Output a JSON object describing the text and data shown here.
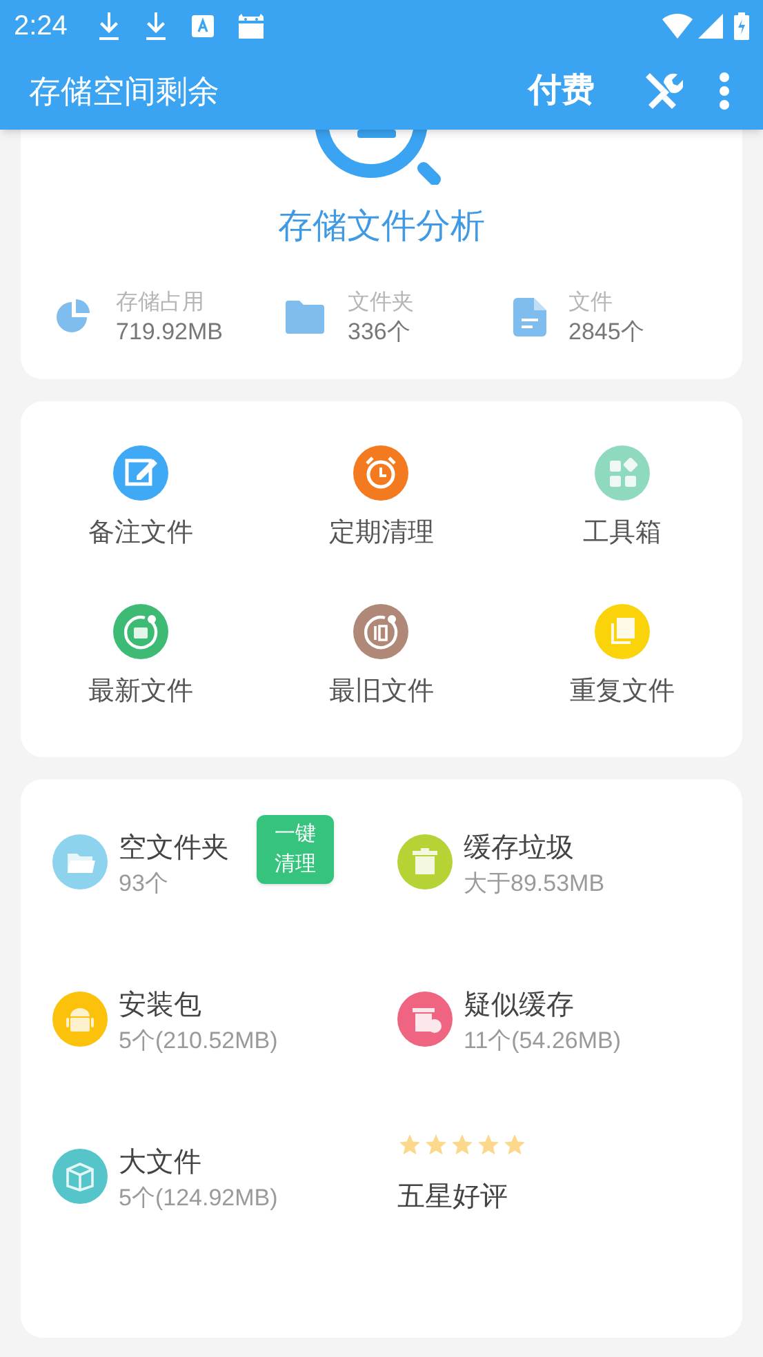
{
  "status_bar": {
    "time": "2:24"
  },
  "app_bar": {
    "title": "存储空间剩余",
    "pay_label": "付费"
  },
  "analysis": {
    "title": "存储文件分析",
    "stats": [
      {
        "kind": "pie",
        "label": "存储占用",
        "value": "719.92MB"
      },
      {
        "kind": "folder",
        "label": "文件夹",
        "value": "336个"
      },
      {
        "kind": "file",
        "label": "文件",
        "value": "2845个"
      }
    ]
  },
  "shortcuts": [
    {
      "kind": "note",
      "label": "备注文件",
      "color": "#3fa9f5"
    },
    {
      "kind": "alarm",
      "label": "定期清理",
      "color": "#f47a20"
    },
    {
      "kind": "grid",
      "label": "工具箱",
      "color": "#8fd9bf"
    },
    {
      "kind": "new",
      "label": "最新文件",
      "color": "#3dbb75"
    },
    {
      "kind": "old",
      "label": "最旧文件",
      "color": "#b08878"
    },
    {
      "kind": "copy",
      "label": "重复文件",
      "color": "#fbd30a"
    }
  ],
  "categories": [
    {
      "kind": "stat",
      "title": "空文件夹",
      "detail": "93个",
      "color": "#8dd3ee",
      "action": "一键清理"
    },
    {
      "kind": "stat",
      "title": "缓存垃圾",
      "detail": "大于89.53MB",
      "color": "#b5d334"
    },
    {
      "kind": "stat",
      "title": "安装包",
      "detail": "5个(210.52MB)",
      "color": "#fcc10b"
    },
    {
      "kind": "stat",
      "title": "疑似缓存",
      "detail": "11个(54.26MB)",
      "color": "#ef6480"
    },
    {
      "kind": "stat",
      "title": "大文件",
      "detail": "5个(124.92MB)",
      "color": "#55c5c9"
    },
    {
      "kind": "rating",
      "title": "五星好评",
      "stars": 5
    }
  ]
}
